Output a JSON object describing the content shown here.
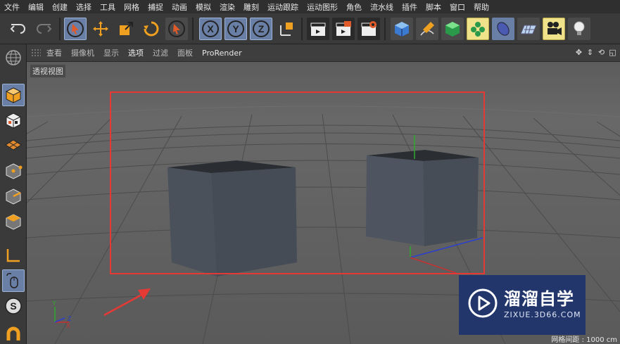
{
  "menu": [
    "文件",
    "编辑",
    "创建",
    "选择",
    "工具",
    "网格",
    "捕捉",
    "动画",
    "模拟",
    "渲染",
    "雕刻",
    "运动跟踪",
    "运动图形",
    "角色",
    "流水线",
    "插件",
    "脚本",
    "窗口",
    "帮助"
  ],
  "toolbar": {
    "undo": "undo-icon",
    "redo": "redo-icon",
    "axis_x": "X",
    "axis_y": "Y",
    "axis_z": "Z"
  },
  "viewport_menu": [
    "查看",
    "摄像机",
    "显示",
    "选项",
    "过滤",
    "面板",
    "ProRender"
  ],
  "viewport_menu_active": "选项",
  "viewport_label": "透视视图",
  "grid_info": "网格间距 : 1000 cm",
  "watermark": {
    "title": "溜溜自学",
    "url": "ZIXUE.3D66.COM"
  },
  "colors": {
    "accent_blue": "#6a7fa6",
    "annotation_red": "#e53935",
    "highlight_yellow": "#efe28b",
    "watermark_bg": "#1e346e"
  }
}
